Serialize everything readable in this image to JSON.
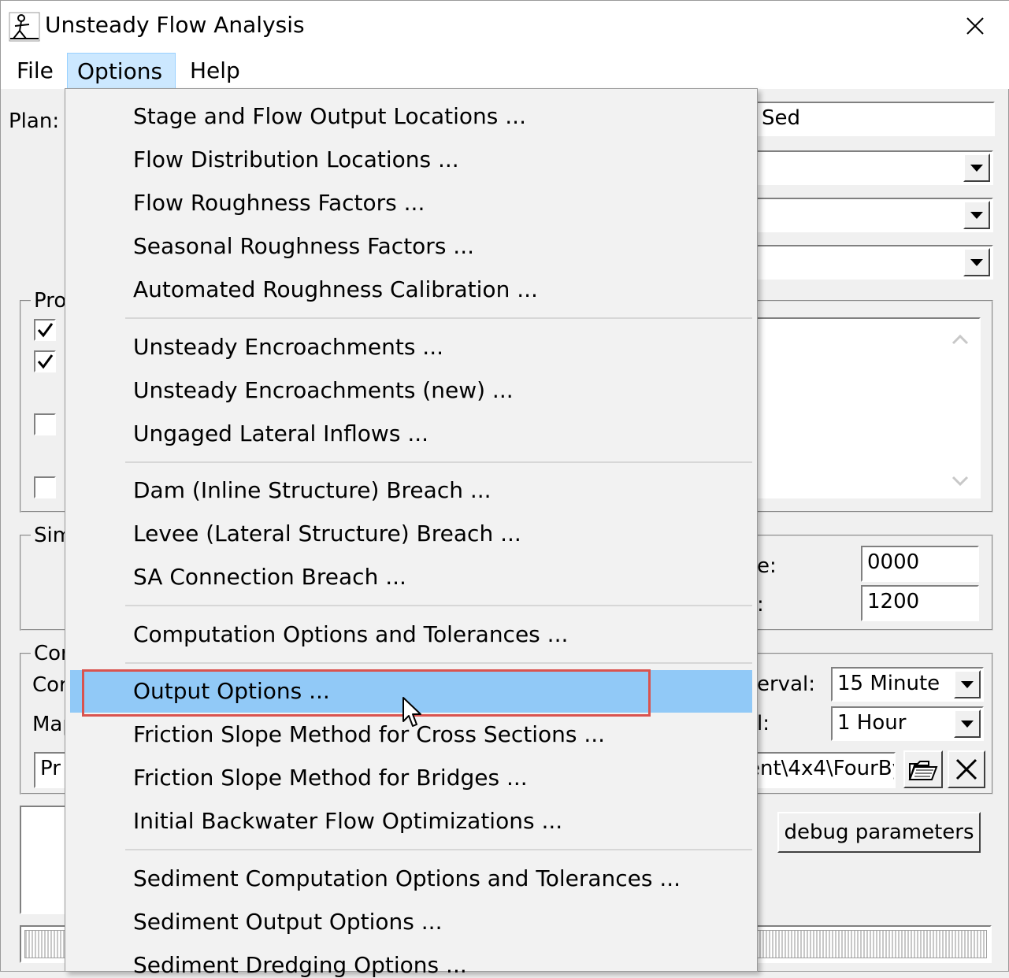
{
  "window": {
    "title": "Unsteady Flow Analysis"
  },
  "menu": {
    "file": "File",
    "options": "Options",
    "help": "Help"
  },
  "form": {
    "plan_label": "Plan:",
    "plan_value": "Sed",
    "group_programs": "Pro",
    "group_simulation": "Sim",
    "starting_time_label": "e:",
    "starting_time_value": "0000",
    "ending_time_label": ":",
    "ending_time_value": "1200",
    "group_computation": "Cor",
    "computation_row_label": "Cor",
    "interval_label": "erval:",
    "interval_value": "15 Minute",
    "mapping_row_label": "Map",
    "mapping_interval_label": "l:",
    "mapping_interval_value": "1 Hour",
    "dss_left_value": "Pr",
    "dss_path_value": "ent\\4x4\\FourBy",
    "debug_button": "debug parameters"
  },
  "dropdown": {
    "items": [
      "Stage and Flow Output Locations ...",
      "Flow Distribution Locations ...",
      "Flow Roughness Factors ...",
      "Seasonal Roughness Factors ...",
      "Automated Roughness Calibration ...",
      "Unsteady Encroachments ...",
      "Unsteady Encroachments (new) ...",
      "Ungaged Lateral Inflows ...",
      "Dam (Inline Structure) Breach ...",
      "Levee (Lateral Structure) Breach ...",
      "SA Connection Breach ...",
      "Computation Options and Tolerances ...",
      "Output Options ...",
      "Friction Slope Method for Cross Sections ...",
      "Friction Slope Method for Bridges ...",
      "Initial Backwater Flow Optimizations ...",
      "Sediment Computation Options and Tolerances ...",
      "Sediment Output Options ...",
      "Sediment Dredging Options ..."
    ],
    "highlight_color": "#91c9f7",
    "annotation_color": "#d9534f"
  }
}
